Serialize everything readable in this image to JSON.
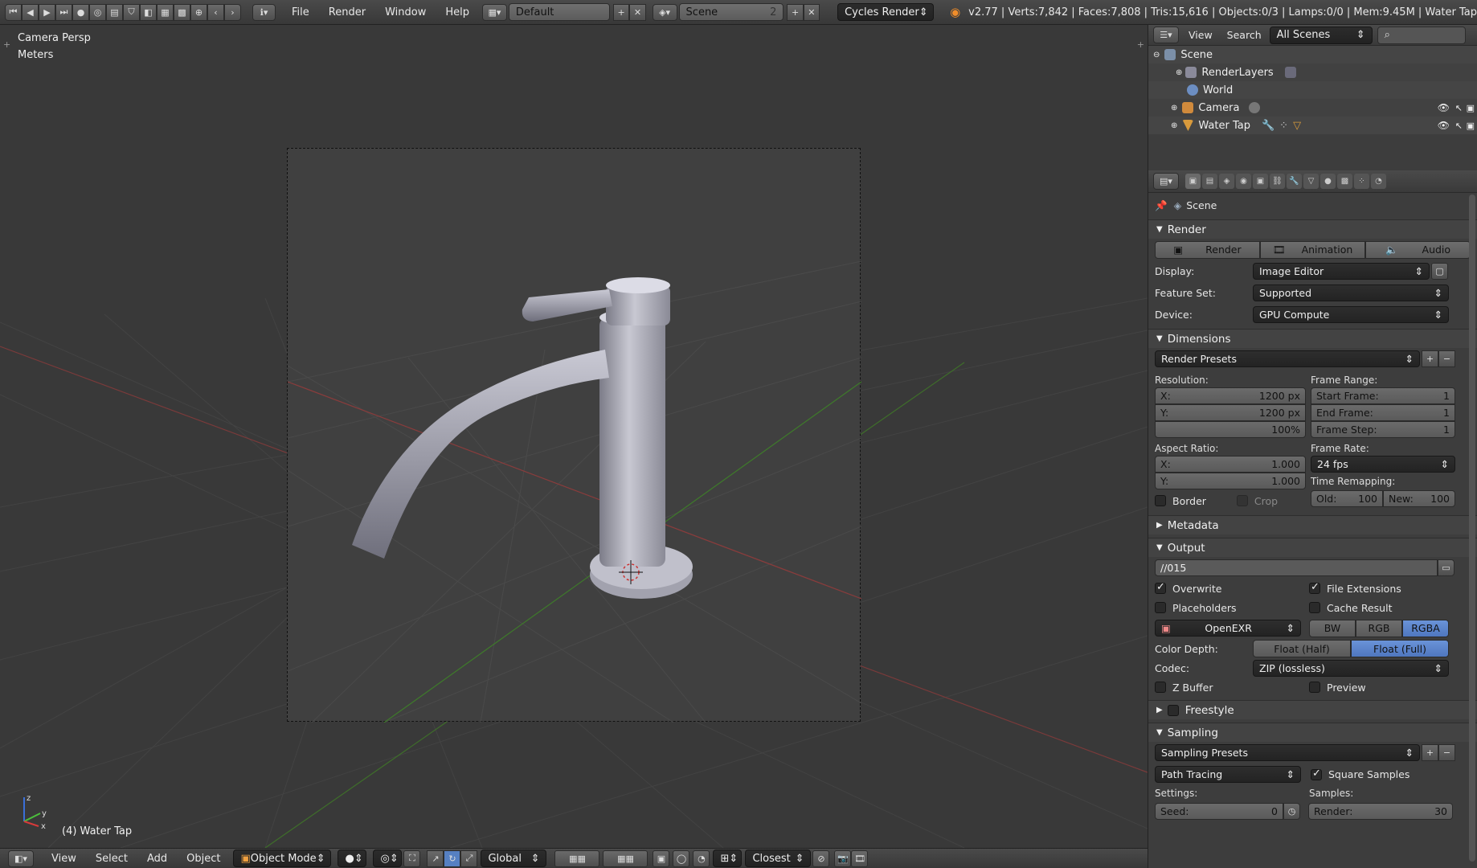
{
  "top": {
    "menus": [
      "File",
      "Render",
      "Window",
      "Help"
    ],
    "layout": "Default",
    "scene": "Scene",
    "scene_users": "2",
    "engine": "Cycles Render",
    "stats": "v2.77 | Verts:7,842 | Faces:7,808 | Tris:15,616 | Objects:0/3 | Lamps:0/0 | Mem:9.45M | Water Tap"
  },
  "viewport": {
    "view_name": "Camera Persp",
    "units": "Meters",
    "object_label": "(4) Water Tap",
    "axis_x": "x",
    "axis_y": "y",
    "axis_z": "z"
  },
  "bottom": {
    "menus": [
      "View",
      "Select",
      "Add",
      "Object"
    ],
    "mode": "Object Mode",
    "orientation": "Global",
    "snap": "Closest"
  },
  "outliner": {
    "menus": [
      "View",
      "Search"
    ],
    "filter": "All Scenes",
    "items": [
      {
        "label": "Scene",
        "icon": "scene-icon"
      },
      {
        "label": "RenderLayers",
        "icon": "render-layers-icon"
      },
      {
        "label": "World",
        "icon": "world-icon"
      },
      {
        "label": "Camera",
        "icon": "camera-icon"
      },
      {
        "label": "Water Tap",
        "icon": "mesh-icon"
      }
    ]
  },
  "props": {
    "context": "Scene",
    "render": {
      "title": "Render",
      "buttons": [
        "Render",
        "Animation",
        "Audio"
      ],
      "display_label": "Display:",
      "display": "Image Editor",
      "feature_label": "Feature Set:",
      "feature": "Supported",
      "device_label": "Device:",
      "device": "GPU Compute"
    },
    "dimensions": {
      "title": "Dimensions",
      "presets": "Render Presets",
      "resolution": "Resolution:",
      "res_x_label": "X:",
      "res_x": "1200 px",
      "res_y_label": "Y:",
      "res_y": "1200 px",
      "res_pct": "100%",
      "frame_range": "Frame Range:",
      "start_label": "Start Frame:",
      "start": "1",
      "end_label": "End Frame:",
      "end": "1",
      "step_label": "Frame Step:",
      "step": "1",
      "aspect": "Aspect Ratio:",
      "asp_x_label": "X:",
      "asp_x": "1.000",
      "asp_y_label": "Y:",
      "asp_y": "1.000",
      "frame_rate": "Frame Rate:",
      "fps": "24 fps",
      "remap": "Time Remapping:",
      "old_label": "Old:",
      "old": "100",
      "new_label": "New:",
      "new": "100",
      "border": "Border",
      "crop": "Crop"
    },
    "metadata": {
      "title": "Metadata"
    },
    "output": {
      "title": "Output",
      "path": "//015",
      "overwrite": "Overwrite",
      "file_ext": "File Extensions",
      "placeholders": "Placeholders",
      "cache": "Cache Result",
      "format": "OpenEXR",
      "bw": "BW",
      "rgb": "RGB",
      "rgba": "RGBA",
      "depth_label": "Color Depth:",
      "half": "Float (Half)",
      "full": "Float (Full)",
      "codec_label": "Codec:",
      "codec": "ZIP (lossless)",
      "zbuffer": "Z Buffer",
      "preview": "Preview"
    },
    "freestyle": {
      "title": "Freestyle"
    },
    "sampling": {
      "title": "Sampling",
      "presets": "Sampling Presets",
      "integrator": "Path Tracing",
      "square": "Square Samples",
      "settings": "Settings:",
      "samples": "Samples:",
      "seed_label": "Seed:",
      "seed": "0",
      "render_label": "Render:",
      "render": "30"
    }
  },
  "colors": {
    "accent": "#5680c2",
    "viewport_bg": "#393939",
    "panel_bg": "#3d3d3d"
  }
}
